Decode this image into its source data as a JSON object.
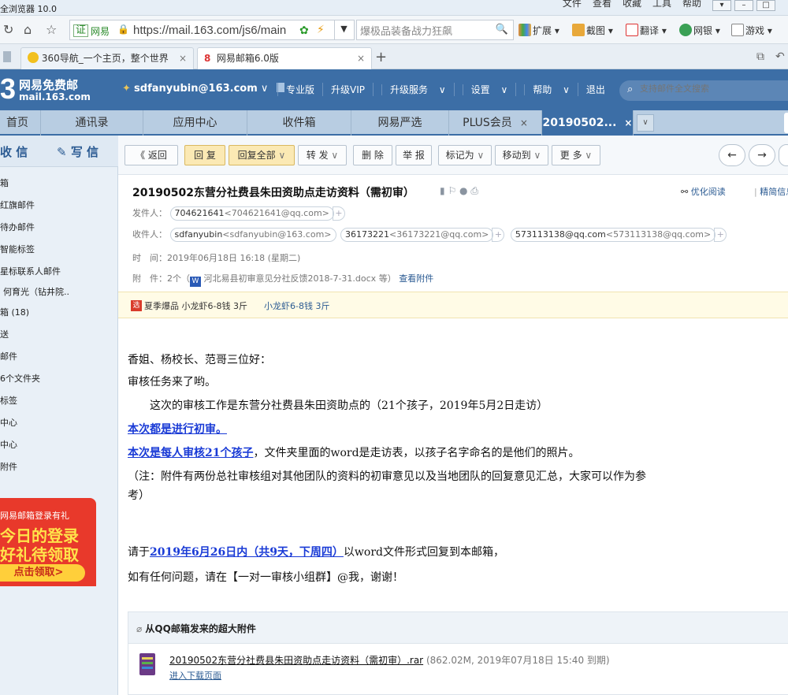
{
  "browser": {
    "title": "全浏览器 10.0",
    "menus": [
      "文件",
      "查看",
      "收藏",
      "工具",
      "帮助"
    ],
    "cert_label": "证",
    "site_name": "网易",
    "url": "https://mail.163.com/js6/main",
    "search_text": "爆极品装备战力狂飙",
    "tools": [
      "扩展",
      "截图",
      "翻译",
      "网银",
      "游戏"
    ],
    "tabs": [
      {
        "label": "360导航_一个主页，整个世界",
        "active": false
      },
      {
        "label": "网易邮箱6.0版",
        "active": true
      }
    ]
  },
  "mail_header": {
    "logo_num": "3",
    "logo_line1": "网易免费邮",
    "logo_line2": "mail.163.com",
    "user": "sdfanyubin@163.com",
    "nav": [
      "专业版",
      "升级VIP",
      "升级服务",
      "设置",
      "帮助",
      "退出"
    ],
    "search_placeholder": "支持邮件全文搜索"
  },
  "mail_tabs": [
    "首页",
    "通讯录",
    "应用中心",
    "收件箱",
    "网易严选",
    "PLUS会员",
    "20190502..."
  ],
  "sidebar": {
    "receive": "收 信",
    "write": "写 信",
    "items": [
      "箱",
      "红旗邮件",
      "待办邮件",
      "智能标签",
      "星标联系人邮件",
      "何育光（钻井院..",
      "箱 (18)",
      "送",
      "邮件",
      "6个文件夹",
      "标签",
      "中心",
      "中心",
      "附件"
    ],
    "promo": {
      "line1": "网易邮箱登录有礼",
      "line2": "今日的登录",
      "line3": "好礼待领取",
      "button": "点击领取>"
    }
  },
  "toolbar": {
    "back": "《 返回",
    "reply": "回 复",
    "reply_all": "回复全部",
    "forward": "转 发",
    "delete": "删 除",
    "report": "举 报",
    "mark_as": "标记为",
    "move_to": "移动到",
    "more": "更 多"
  },
  "message": {
    "subject": "20190502东营分社费县朱田资助点走访资料（需初审）",
    "optimize_read": "优化阅读",
    "precise": "精简信息",
    "from_label": "发件人：",
    "from_name": "704621641",
    "from_email": "<704621641@qq.com>",
    "to_label": "收件人：",
    "recipients": [
      {
        "name": "sdfanyubin",
        "email": "<sdfanyubin@163.com>"
      },
      {
        "name": "36173221",
        "email": "<36173221@qq.com>"
      },
      {
        "name": "573113138@qq.com",
        "email": "<573113138@qq.com>"
      }
    ],
    "time_label": "时　间：",
    "time": "2019年06月18日 16:18 (星期二)",
    "attach_label": "附　件：",
    "attach_count": "2个（",
    "attach_file": "河北易县初审意见分社反馈2018-7-31.docx 等）",
    "attach_view": "查看附件",
    "ad_tag": "选",
    "ad_text": "夏季爆品 小龙虾6-8钱 3斤",
    "ad_link": "小龙虾6-8钱 3斤",
    "body": {
      "greeting": "香姐、杨校长、范哥三位好：",
      "line2": "审核任务来了哟。",
      "line3": "　　这次的审核工作是东营分社费县朱田资助点的（21个孩子，2019年5月2日走访）",
      "line4_link": "本次都是进行初审。",
      "line5_link": "本次是每人审核21个孩子",
      "line5_rest": "，文件夹里面的word是走访表，以孩子名字命名的是他们的照片。",
      "line6": "（注：附件有两份总社审核组对其他团队的资料的初审意见以及当地团队的回复意见汇总，大家可以作为参",
      "line7": "考）",
      "line8_pre": "请于",
      "line8_link": "2019年6月26日内（共9天，下周四）",
      "line8_post": "以word文件形式回复到本邮箱，",
      "line9": "如有任何问题，请在【一对一审核小组群】@我，谢谢！"
    },
    "big_attach_title": "从QQ邮箱发来的超大附件",
    "big_attach_name": "20190502东营分社费县朱田资助点走访资料（需初审）.rar",
    "big_attach_info": "(862.02M, 2019年07月18日 15:40 到期)",
    "big_attach_link": "进入下载页面"
  }
}
